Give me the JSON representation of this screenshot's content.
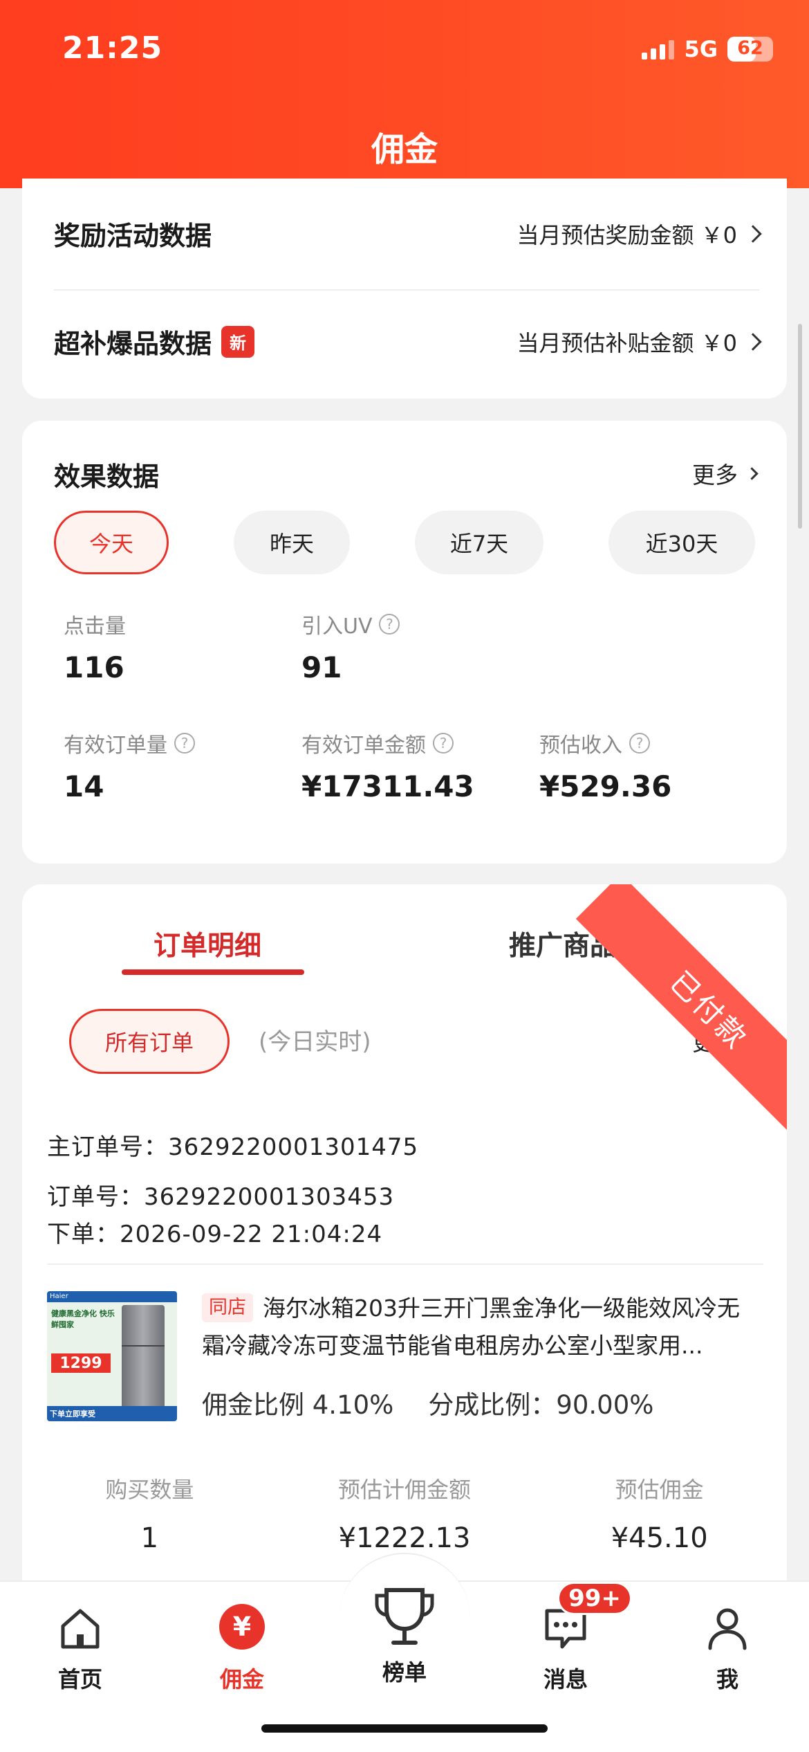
{
  "status_bar": {
    "time": "21:25",
    "network": "5G",
    "battery": "62",
    "battery_level": 0.62
  },
  "nav": {
    "title": "佣金"
  },
  "rewards": {
    "activity": {
      "label": "奖励活动数据",
      "value_text": "当月预估奖励金额 ￥0"
    },
    "subsidy": {
      "label": "超补爆品数据",
      "badge": "新",
      "value_text": "当月预估补贴金额 ￥0"
    }
  },
  "effect": {
    "title": "效果数据",
    "more": "更多",
    "ranges": [
      "今天",
      "昨天",
      "近7天",
      "近30天"
    ],
    "active_range": "今天",
    "metrics": {
      "clicks": {
        "label": "点击量",
        "value": "116"
      },
      "uv": {
        "label": "引入UV",
        "value": "91"
      },
      "orders": {
        "label": "有效订单量",
        "value": "14"
      },
      "order_amount": {
        "label": "有效订单金额",
        "value": "¥17311.43"
      },
      "income": {
        "label": "预估收入",
        "value": "¥529.36"
      }
    },
    "help_glyph": "?"
  },
  "orders": {
    "tabs": [
      "订单明细",
      "推广商品分析"
    ],
    "filter": "所有订单",
    "realtime": "(今日实时)",
    "more": "更多",
    "item": {
      "status": "已付款",
      "main_order_no": "主订单号：3629220001301475",
      "order_no": "订单号：3629220001303453",
      "placed": "下单：2026-09-22 21:04:24",
      "shop_tag": "同店",
      "title": "海尔冰箱203升三开门黑金净化一级能效风冷无霜冷藏冷冻可变温节能省电租房办公室小型家用...",
      "commission_rate": "佣金比例 4.10%",
      "share_rate": "分成比例：90.00%",
      "image": {
        "brand": "Haier",
        "headline": "健康黑金净化 快乐鲜囤家",
        "price": "1299",
        "footer": "下单立即享受"
      },
      "stats": [
        {
          "label": "购买数量",
          "value": "1"
        },
        {
          "label": "预估计佣金额",
          "value": "¥1222.13"
        },
        {
          "label": "预估佣金",
          "value": "¥45.10"
        }
      ]
    }
  },
  "tabbar": {
    "items": [
      "首页",
      "佣金",
      "榜单",
      "消息",
      "我"
    ],
    "active": "佣金",
    "yen_glyph": "¥",
    "message_badge": "99+"
  },
  "colors": {
    "brand": "#ff4a24",
    "accent": "#e8332a"
  },
  "icons": [
    "home-icon",
    "yen-icon",
    "trophy-icon",
    "message-icon",
    "user-icon"
  ]
}
